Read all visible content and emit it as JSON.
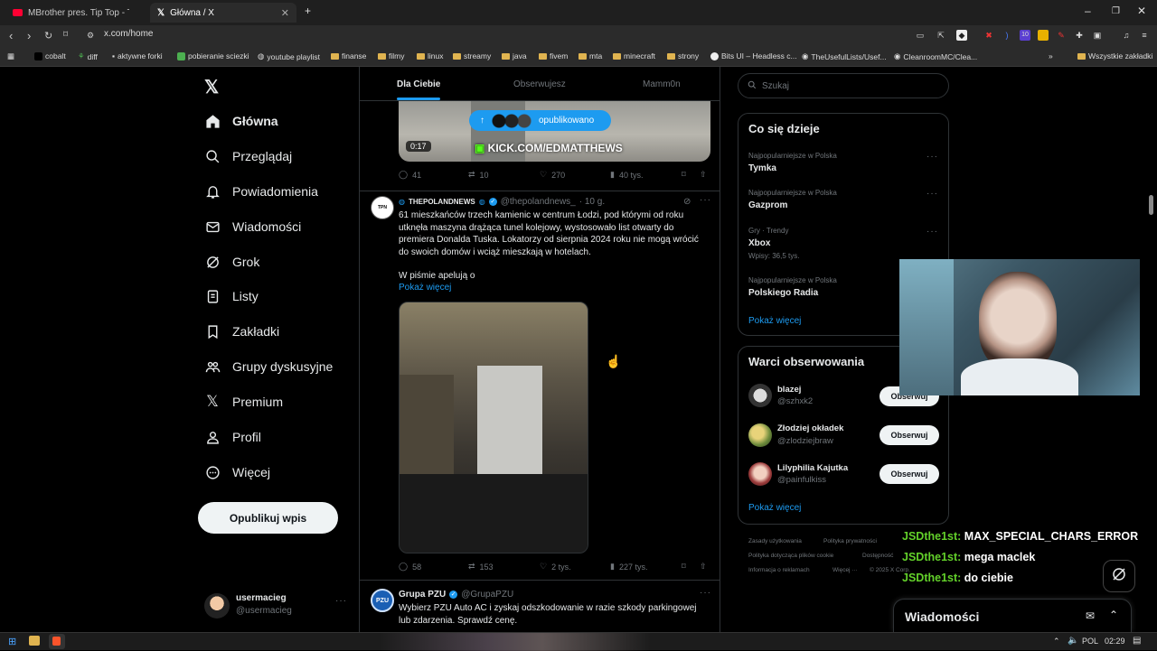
{
  "browser": {
    "tabs": [
      {
        "label": "MBrother pres. Tip Top - Tell Me",
        "icon": "youtube-icon"
      },
      {
        "label": "Główna / X",
        "icon": "x-logo-icon"
      }
    ],
    "url": "x.com/home",
    "bookmarks": [
      "cobalt",
      "diff",
      "aktywne forki",
      "pobieranie sciezki",
      "youtube playlist",
      "finanse",
      "filmy",
      "linux",
      "streamy",
      "java",
      "fivem",
      "mta",
      "minecraft",
      "strony",
      "Bits UI – Headless c...",
      "TheUsefulLists/Usef...",
      "CleanroomMC/Clea...",
      "Wszystkie zakładki"
    ],
    "ext_badge": "10"
  },
  "nav": {
    "items": [
      {
        "label": "Główna",
        "icon": "home-icon"
      },
      {
        "label": "Przeglądaj",
        "icon": "search-icon"
      },
      {
        "label": "Powiadomienia",
        "icon": "bell-icon"
      },
      {
        "label": "Wiadomości",
        "icon": "mail-icon"
      },
      {
        "label": "Grok",
        "icon": "grok-icon"
      },
      {
        "label": "Listy",
        "icon": "list-icon"
      },
      {
        "label": "Zakładki",
        "icon": "bookmark-icon"
      },
      {
        "label": "Grupy dyskusyjne",
        "icon": "communities-icon"
      },
      {
        "label": "Premium",
        "icon": "x-logo-icon"
      },
      {
        "label": "Profil",
        "icon": "person-icon"
      },
      {
        "label": "Więcej",
        "icon": "more-circle-icon"
      }
    ],
    "post_button": "Opublikuj wpis",
    "account": {
      "name": "usermacieg",
      "handle": "@usermacieg"
    }
  },
  "feed": {
    "tabs": [
      "Dla Ciebie",
      "Obserwujesz",
      "Mamm0n"
    ],
    "video_tweet": {
      "duration": "0:17",
      "overlay_text": "KICK.COM/EDMATTHEWS",
      "published_pill": "opublikowano",
      "replies": "41",
      "reposts": "10",
      "likes": "270",
      "views": "40 tys."
    },
    "tweet1": {
      "name": "THEPOLANDNEWS",
      "handle": "@thepolandnews_",
      "time": "· 10 g.",
      "text": "61 mieszkańców trzech kamienic w centrum Łodzi, pod którymi od roku utknęła maszyna drążąca tunel kolejowy, wystosowało list otwarty do premiera Donalda Tuska. Lokatorzy od sierpnia 2024 roku nie mogą wrócić do swoich domów i wciąż mieszkają w hotelach.",
      "text2": "W piśmie apelują o",
      "show_more": "Pokaż więcej",
      "replies": "58",
      "reposts": "153",
      "likes": "2 tys.",
      "views": "227 tys."
    },
    "tweet2": {
      "name": "Grupa PZU",
      "handle": "@GrupaPZU",
      "avatar_text": "PZU",
      "text": "Wybierz PZU Auto AC i zyskaj odszkodowanie w razie szkody parkingowej lub zdarzenia. Sprawdź cenę."
    }
  },
  "right": {
    "search_placeholder": "Szukaj",
    "trends_title": "Co się dzieje",
    "trends": [
      {
        "category": "Najpopularniejsze w Polska",
        "name": "Tymka",
        "count": ""
      },
      {
        "category": "Najpopularniejsze w Polska",
        "name": "Gazprom",
        "count": ""
      },
      {
        "category": "Gry · Trendy",
        "name": "Xbox",
        "count": "Wpisy: 36,5 tys."
      },
      {
        "category": "Najpopularniejsze w Polska",
        "name": "Polskiego Radia",
        "count": ""
      }
    ],
    "trends_more": "Pokaż więcej",
    "who_title": "Warci obserwowania",
    "who": [
      {
        "name": "blazej",
        "handle": "@szhxk2",
        "button": "Obserwuj"
      },
      {
        "name": "Złodziej okładek",
        "handle": "@zlodziejbraw",
        "button": "Obserwuj"
      },
      {
        "name": "Lilyphilia Kajutka",
        "handle": "@painfulkiss",
        "button": "Obserwuj"
      }
    ],
    "who_more": "Pokaż więcej",
    "footer": [
      "Zasady użytkowania",
      "Polityka prywatności",
      "Polityka dotycząca plików cookie",
      "Dostępność",
      "Informacja o reklamach",
      "Więcej ···",
      "© 2025 X Corp."
    ]
  },
  "chat": [
    {
      "user": "JSDthe1st:",
      "msg": "MAX_SPECIAL_CHARS_ERROR"
    },
    {
      "user": "JSDthe1st:",
      "msg": "mega maclek"
    },
    {
      "user": "JSDthe1st:",
      "msg": "do ciebie"
    }
  ],
  "messages_drawer": {
    "title": "Wiadomości"
  },
  "taskbar": {
    "lang": "POL",
    "time": "02:29"
  }
}
